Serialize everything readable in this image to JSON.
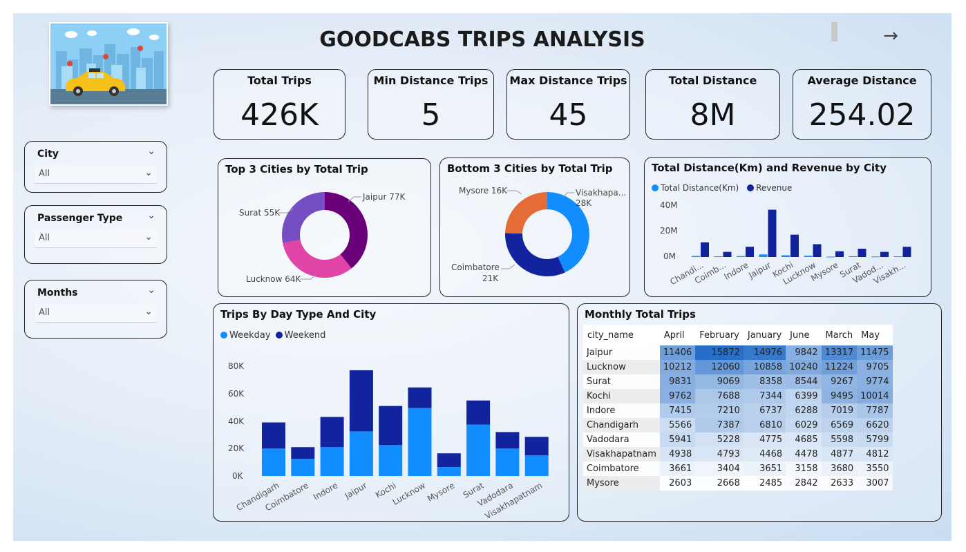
{
  "dashboard": {
    "title": "GOODCABS TRIPS ANALYSIS"
  },
  "nav": {
    "next_icon": "arrow-right-icon",
    "next_glyph": "→"
  },
  "kpis": [
    {
      "title": "Total Trips",
      "value": "426K"
    },
    {
      "title": "Min Distance Trips",
      "value": "5"
    },
    {
      "title": "Max Distance Trips",
      "value": "45"
    },
    {
      "title": "Total Distance",
      "value": "8M"
    },
    {
      "title": "Average Distance",
      "value": "254.02"
    }
  ],
  "slicers": [
    {
      "label": "City",
      "value": "All"
    },
    {
      "label": "Passenger Type",
      "value": "All"
    },
    {
      "label": "Months",
      "value": "All"
    }
  ],
  "colors": {
    "light_blue": "#118DFF",
    "dark_blue": "#12239E",
    "purple_dark": "#6B007B",
    "magenta": "#E044A7",
    "purple": "#744EC2",
    "orange": "#E66C37"
  },
  "top3": {
    "title": "Top 3 Cities by Total Trip",
    "labels": [
      "Jaipur 77K",
      "Lucknow 64K",
      "Surat 55K"
    ]
  },
  "bottom3": {
    "title": "Bottom 3 Cities by Total Trip",
    "labels": [
      "Visakhapa...",
      "28K",
      "Coimbatore",
      "21K",
      "Mysore 16K"
    ]
  },
  "dist_rev": {
    "title": "Total Distance(Km) and Revenue by City",
    "legend": [
      "Total Distance(Km)",
      "Revenue"
    ],
    "ticks": [
      "40M",
      "20M",
      "0M"
    ]
  },
  "daytype": {
    "title": "Trips By Day Type And City",
    "legend": [
      "Weekday",
      "Weekend"
    ],
    "ticks": [
      "80K",
      "60K",
      "40K",
      "20K",
      "0K"
    ]
  },
  "monthly": {
    "title": "Monthly Total Trips",
    "headers": [
      "city_name",
      "April",
      "February",
      "January",
      "June",
      "March",
      "May"
    ],
    "rows": [
      [
        "Jaipur",
        "11406",
        "15872",
        "14976",
        "9842",
        "13317",
        "11475"
      ],
      [
        "Lucknow",
        "10212",
        "12060",
        "10858",
        "10240",
        "11224",
        "9705"
      ],
      [
        "Surat",
        "9831",
        "9069",
        "8358",
        "8544",
        "9267",
        "9774"
      ],
      [
        "Kochi",
        "9762",
        "7688",
        "7344",
        "6399",
        "9495",
        "10014"
      ],
      [
        "Indore",
        "7415",
        "7210",
        "6737",
        "6288",
        "7019",
        "7787"
      ],
      [
        "Chandigarh",
        "5566",
        "7387",
        "6810",
        "6029",
        "6569",
        "6620"
      ],
      [
        "Vadodara",
        "5941",
        "5228",
        "4775",
        "4685",
        "5598",
        "5799"
      ],
      [
        "Visakhapatnam",
        "4938",
        "4793",
        "4468",
        "4478",
        "4877",
        "4812"
      ],
      [
        "Coimbatore",
        "3661",
        "3404",
        "3651",
        "3158",
        "3680",
        "3550"
      ],
      [
        "Mysore",
        "2603",
        "2668",
        "2485",
        "2842",
        "2633",
        "3007"
      ]
    ]
  },
  "chart_data": [
    {
      "type": "pie",
      "title": "Top 3 Cities by Total Trip",
      "categories": [
        "Jaipur",
        "Lucknow",
        "Surat"
      ],
      "values": [
        77000,
        64000,
        55000
      ]
    },
    {
      "type": "pie",
      "title": "Bottom 3 Cities by Total Trip",
      "categories": [
        "Visakhapatnam",
        "Coimbatore",
        "Mysore"
      ],
      "values": [
        28000,
        21000,
        16000
      ]
    },
    {
      "type": "bar",
      "title": "Total Distance(Km) and Revenue by City",
      "categories": [
        "Chandi...",
        "Coimb...",
        "Indore",
        "Jaipur",
        "Kochi",
        "Lucknow",
        "Mysore",
        "Surat",
        "Vadod...",
        "Visakh..."
      ],
      "series": [
        {
          "name": "Total Distance(Km)",
          "values": [
            0.8,
            0.5,
            0.7,
            2.0,
            1.3,
            1.0,
            0.3,
            0.6,
            0.4,
            0.5
          ]
        },
        {
          "name": "Revenue",
          "values": [
            11.5,
            4.0,
            8.0,
            37.0,
            17.5,
            10.0,
            4.5,
            6.5,
            4.0,
            8.0
          ]
        }
      ],
      "ylabel": "",
      "ylim": [
        0,
        40
      ],
      "unit": "M",
      "legend": "top-left"
    },
    {
      "type": "bar",
      "stacked": true,
      "title": "Trips By Day Type And City",
      "categories": [
        "Chandigarh",
        "Coimbatore",
        "Indore",
        "Jaipur",
        "Kochi",
        "Lucknow",
        "Mysore",
        "Surat",
        "Vadodara",
        "Visakhapatnam"
      ],
      "series": [
        {
          "name": "Weekday",
          "values": [
            20000,
            12500,
            21000,
            32500,
            22500,
            49500,
            6500,
            37500,
            20000,
            15000
          ]
        },
        {
          "name": "Weekend",
          "values": [
            19000,
            8500,
            22000,
            44500,
            28500,
            15000,
            10000,
            17500,
            12000,
            13500
          ]
        }
      ],
      "ylim": [
        0,
        80000
      ],
      "legend": "top-left"
    },
    {
      "type": "table",
      "title": "Monthly Total Trips",
      "columns": [
        "city_name",
        "April",
        "February",
        "January",
        "June",
        "March",
        "May"
      ],
      "rows": [
        [
          "Jaipur",
          11406,
          15872,
          14976,
          9842,
          13317,
          11475
        ],
        [
          "Lucknow",
          10212,
          12060,
          10858,
          10240,
          11224,
          9705
        ],
        [
          "Surat",
          9831,
          9069,
          8358,
          8544,
          9267,
          9774
        ],
        [
          "Kochi",
          9762,
          7688,
          7344,
          6399,
          9495,
          10014
        ],
        [
          "Indore",
          7415,
          7210,
          6737,
          6288,
          7019,
          7787
        ],
        [
          "Chandigarh",
          5566,
          7387,
          6810,
          6029,
          6569,
          6620
        ],
        [
          "Vadodara",
          5941,
          5228,
          4775,
          4685,
          5598,
          5799
        ],
        [
          "Visakhapatnam",
          4938,
          4793,
          4468,
          4478,
          4877,
          4812
        ],
        [
          "Coimbatore",
          3661,
          3404,
          3651,
          3158,
          3680,
          3550
        ],
        [
          "Mysore",
          2603,
          2668,
          2485,
          2842,
          2633,
          3007
        ]
      ]
    }
  ]
}
